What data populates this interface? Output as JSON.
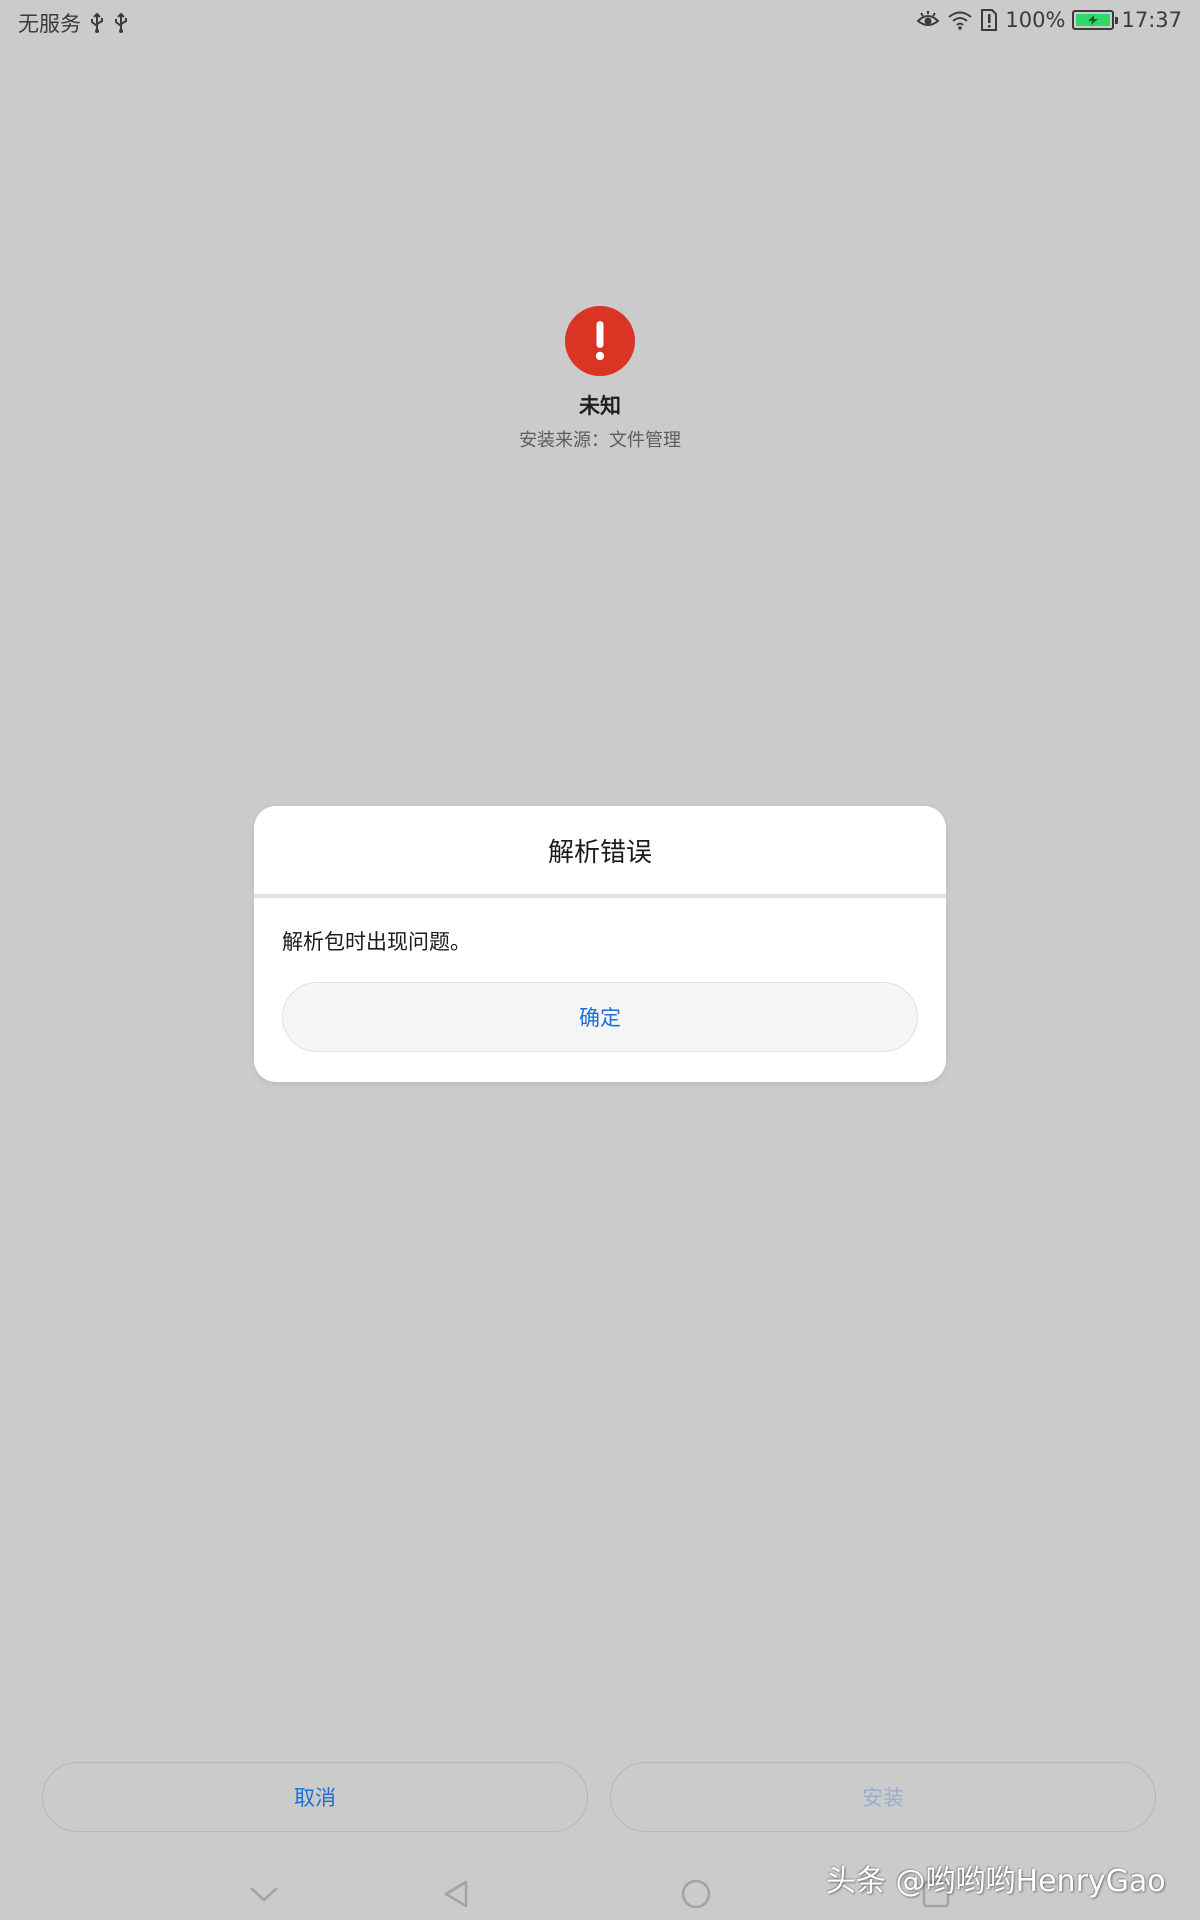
{
  "status_bar": {
    "carrier": "无服务",
    "battery_percent": "100%",
    "time": "17:37",
    "battery_color": "#2fd86a"
  },
  "app": {
    "name": "未知",
    "source": "安装来源：文件管理",
    "icon": "exclamation-icon",
    "icon_color": "#d93424"
  },
  "dialog": {
    "title": "解析错误",
    "message": "解析包时出现问题。",
    "ok_label": "确定"
  },
  "actions": {
    "cancel_label": "取消",
    "install_label": "安装"
  },
  "watermark": "头条 @哟哟哟HenryGao",
  "colors": {
    "background": "#cbcbcb",
    "accent": "#1a6fd8"
  }
}
